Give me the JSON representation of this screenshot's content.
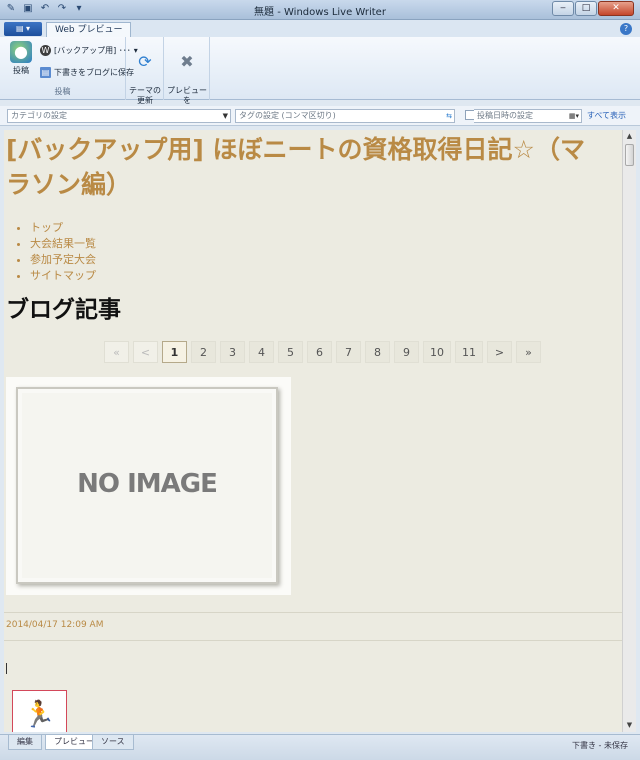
{
  "window": {
    "title": "無題 - Windows Live Writer"
  },
  "ribbon": {
    "tab": "Web プレビュー",
    "publish_label": "投稿",
    "blog_select": "[バックアップ用] ･･･",
    "save_draft": "下書きをブログに保存",
    "group_label": "投稿",
    "update_theme": "テーマの\n更新",
    "close_preview": "プレビューを\n閉じる"
  },
  "props": {
    "category_placeholder": "カテゴリの設定",
    "tags_placeholder": "タグの設定 (コンマ区切り)",
    "post_date": "投稿日時の設定",
    "show_all": "すべて表示"
  },
  "blog": {
    "title": "[バックアップ用] ほぼニートの資格取得日記☆（マラソン編）",
    "nav": [
      "トップ",
      "大会結果一覧",
      "参加予定大会",
      "サイトマップ"
    ],
    "section_heading": "ブログ記事",
    "pager": [
      "«",
      "<",
      "1",
      "2",
      "3",
      "4",
      "5",
      "6",
      "7",
      "8",
      "9",
      "10",
      "11",
      ">",
      "»"
    ],
    "current_page": "1",
    "no_image": "NO IMAGE",
    "post_date": "2014/04/17 12:09 AM"
  },
  "bottom": {
    "tabs": [
      "編集",
      "プレビュー",
      "ソース"
    ],
    "status": "下書き - 未保存"
  }
}
